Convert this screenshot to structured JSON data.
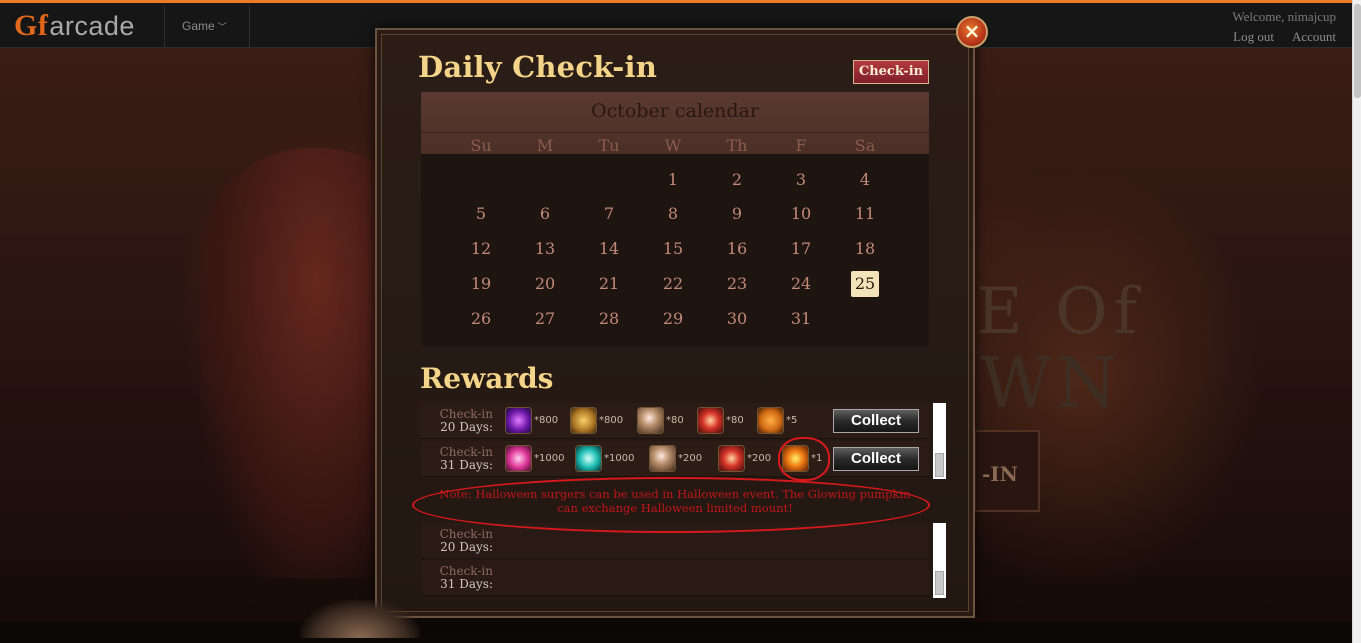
{
  "header": {
    "brand_prefix": "Gf",
    "brand_name": "arcade",
    "menu_game": "Game",
    "welcome": "Welcome, nimajcup",
    "logout": "Log out",
    "account": "Account"
  },
  "background": {
    "logo_line1": "E Of",
    "logo_line2": "WN",
    "play_btn": "-IN"
  },
  "modal": {
    "title": "Daily Check-in",
    "checkin_button": "Check-in",
    "close_icon": "×",
    "calendar": {
      "month_title": "October calendar",
      "weekdays": [
        "Su",
        "M",
        "Tu",
        "W",
        "Th",
        "F",
        "Sa"
      ],
      "weeks": [
        [
          "",
          "",
          "",
          "1",
          "2",
          "3",
          "4"
        ],
        [
          "5",
          "6",
          "7",
          "8",
          "9",
          "10",
          "11"
        ],
        [
          "12",
          "13",
          "14",
          "15",
          "16",
          "17",
          "18"
        ],
        [
          "19",
          "20",
          "21",
          "22",
          "23",
          "24",
          "25"
        ],
        [
          "26",
          "27",
          "28",
          "29",
          "30",
          "31",
          ""
        ]
      ],
      "today": "25"
    },
    "rewards_title": "Rewards",
    "rewards": [
      {
        "label_top": "Check-in",
        "label_bottom": "20 Days:",
        "items": [
          {
            "icon": "purple-orb-icon",
            "qty": "*800"
          },
          {
            "icon": "gold-chest-icon",
            "qty": "*800"
          },
          {
            "icon": "pearl-orb-icon",
            "qty": "*80"
          },
          {
            "icon": "red-gem-icon",
            "qty": "*80"
          },
          {
            "icon": "pumpkin-icon",
            "qty": "*5"
          }
        ],
        "button": "Collect"
      },
      {
        "label_top": "Check-in",
        "label_bottom": "31 Days:",
        "items": [
          {
            "icon": "pink-star-icon",
            "qty": "*1000"
          },
          {
            "icon": "cyan-gem-icon",
            "qty": "*1000"
          },
          {
            "icon": "pearl-orb-icon",
            "qty": "*200"
          },
          {
            "icon": "red-gem-icon",
            "qty": "*200"
          },
          {
            "icon": "glowing-pumpkin-icon",
            "qty": "*1"
          }
        ],
        "button": "Collect"
      }
    ],
    "note_line1": "Note: Halloween surgers can be used in Halloween event. The Glowing pumpkin",
    "note_line2": "can exchange Halloween limited mount!",
    "rewards_empty": [
      {
        "label_top": "Check-in",
        "label_bottom": "20 Days:"
      },
      {
        "label_top": "Check-in",
        "label_bottom": "31 Days:"
      }
    ]
  },
  "colors": {
    "accent_orange": "#ef7b28",
    "title_gold": "#f3d488",
    "note_red": "#c0161a",
    "annotation_red": "#d7191c"
  }
}
